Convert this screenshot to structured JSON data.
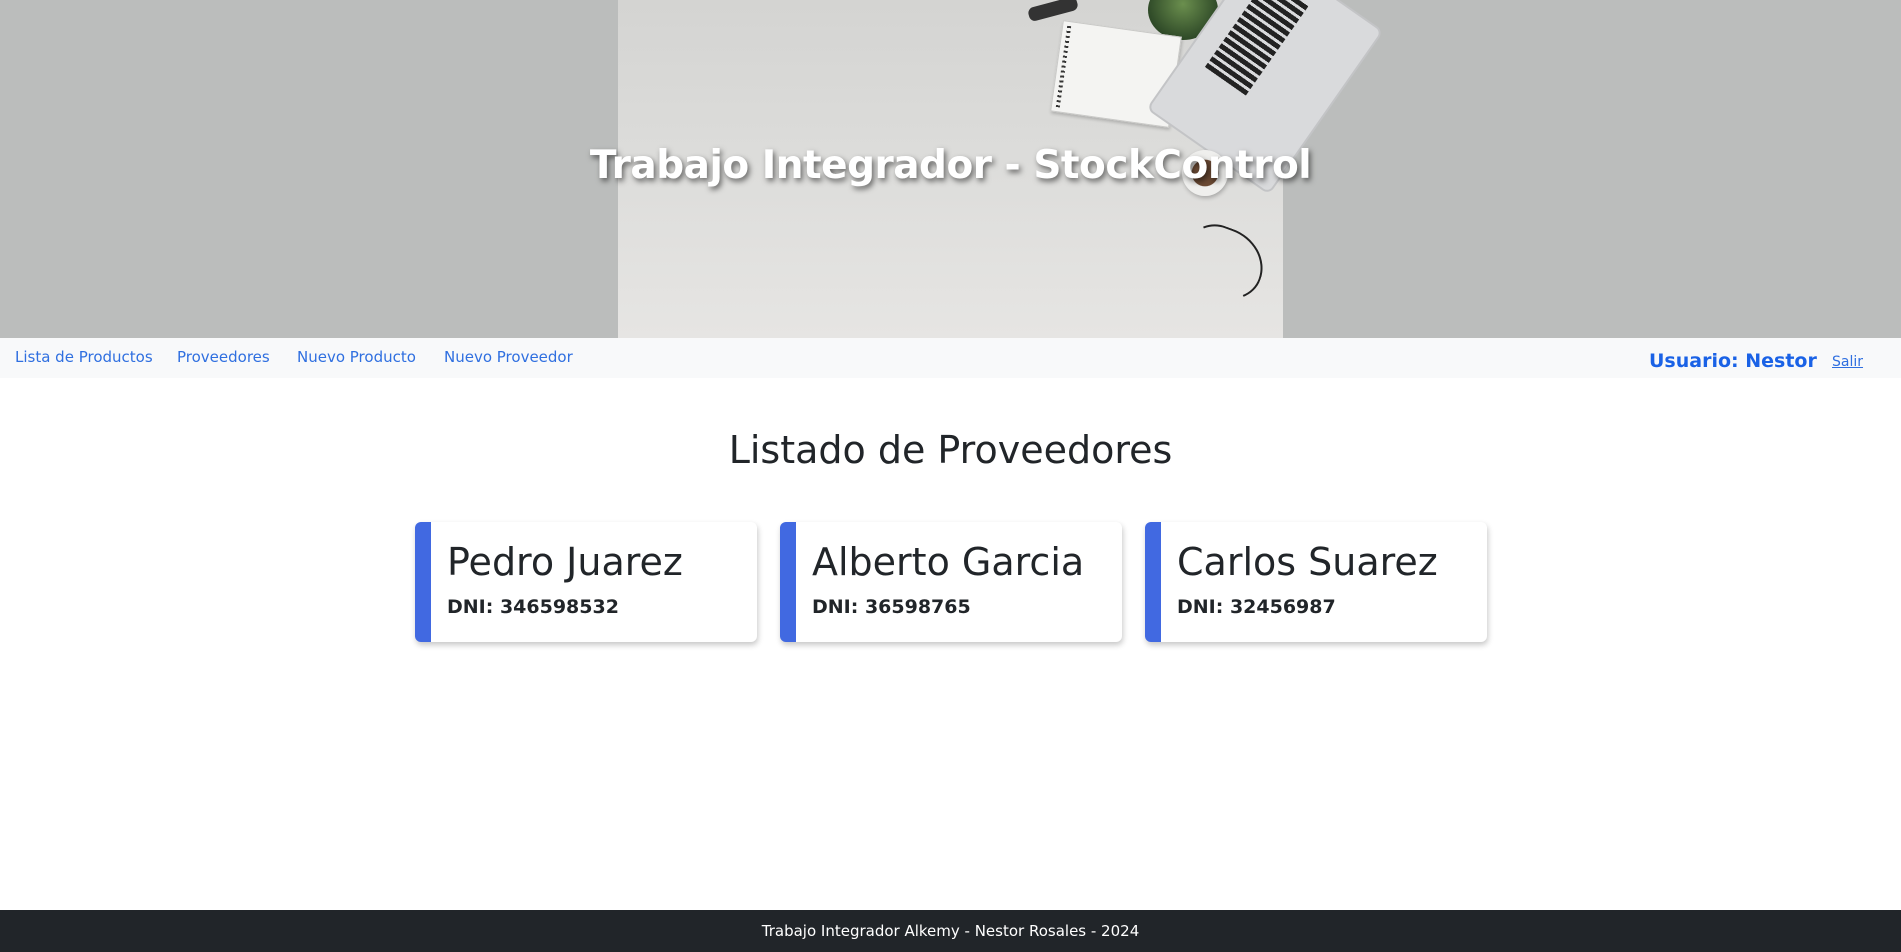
{
  "header": {
    "title": "Trabajo Integrador - StockControl"
  },
  "nav": {
    "links": [
      {
        "label": "Lista de Productos"
      },
      {
        "label": "Proveedores"
      },
      {
        "label": "Nuevo Producto"
      },
      {
        "label": "Nuevo Proveedor"
      }
    ],
    "user_label": "Usuario: Nestor",
    "logout_label": "Salir"
  },
  "main": {
    "title": "Listado de Proveedores",
    "providers": [
      {
        "name": "Pedro Juarez",
        "dni": "DNI: 346598532"
      },
      {
        "name": "Alberto Garcia",
        "dni": "DNI: 36598765"
      },
      {
        "name": "Carlos Suarez",
        "dni": "DNI: 32456987"
      }
    ]
  },
  "footer": {
    "text": "Trabajo Integrador Alkemy - Nestor Rosales - 2024"
  },
  "colors": {
    "accent": "#4169e1",
    "link": "#2f6fe0",
    "footer_bg": "#212529",
    "banner_bg": "#bbbdbc"
  }
}
